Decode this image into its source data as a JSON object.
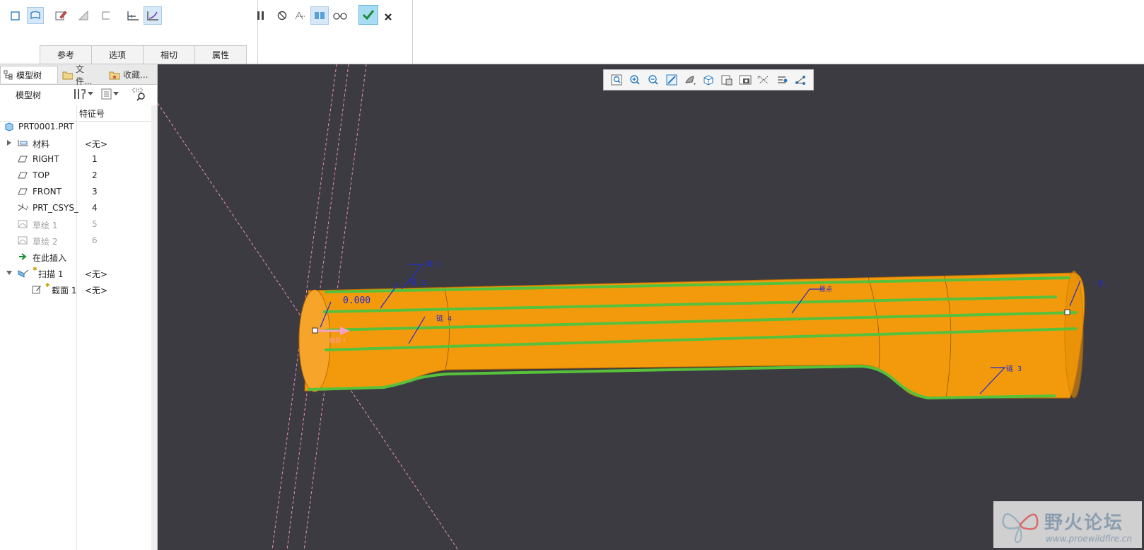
{
  "ribbon": {
    "tabs": [
      "参考",
      "选项",
      "相切",
      "属性"
    ],
    "left_icons": [
      "solid-icon",
      "surface-icon",
      "sketch-edit-icon",
      "remove-material-icon",
      "thin-icon",
      "constant-section-icon",
      "variable-section-icon"
    ],
    "mid_icons": [
      "pause-icon",
      "no-preview-icon",
      "geometry-preview-icon",
      "verify-preview-icon",
      "glasses-icon",
      "confirm-icon",
      "cancel-icon"
    ]
  },
  "panel": {
    "tabs": [
      "模型树",
      "文件...",
      "收藏..."
    ],
    "toolbar_label": "模型树",
    "column_header": "特征号",
    "tree": [
      {
        "name": "PRT0001.PRT",
        "num": "",
        "icon": "part-icon",
        "indent": 0,
        "dim": false
      },
      {
        "name": "材料",
        "num": "<无>",
        "icon": "material-icon",
        "indent": 1,
        "dim": false,
        "expander": true
      },
      {
        "name": "RIGHT",
        "num": "1",
        "icon": "datum-plane-icon",
        "indent": 1,
        "dim": false
      },
      {
        "name": "TOP",
        "num": "2",
        "icon": "datum-plane-icon",
        "indent": 1,
        "dim": false
      },
      {
        "name": "FRONT",
        "num": "3",
        "icon": "datum-plane-icon",
        "indent": 1,
        "dim": false
      },
      {
        "name": "PRT_CSYS_",
        "num": "4",
        "icon": "csys-icon",
        "indent": 1,
        "dim": false
      },
      {
        "name": "草绘 1",
        "num": "5",
        "icon": "sketch-icon",
        "indent": 1,
        "dim": true
      },
      {
        "name": "草绘 2",
        "num": "6",
        "icon": "sketch-icon",
        "indent": 1,
        "dim": true
      },
      {
        "name": "在此插入",
        "num": "",
        "icon": "insert-here-icon",
        "indent": 1,
        "dim": false
      },
      {
        "name": "扫描 1",
        "num": "<无>",
        "icon": "sweep-icon",
        "indent": 1,
        "dim": false,
        "expander": true
      },
      {
        "name": "截面 1",
        "num": "<无>",
        "icon": "section-icon",
        "indent": 2,
        "dim": false
      }
    ]
  },
  "viewport": {
    "toolbar_icons": [
      "refit-icon",
      "zoom-in-icon",
      "zoom-out-icon",
      "repaint-icon",
      "display-style-icon",
      "saved-orientations-icon",
      "view-manager-icon",
      "perspective-icon",
      "datum-display-icon",
      "spin-center-icon",
      "annotation-display-icon"
    ],
    "labels": {
      "chain1": "链 1",
      "chain2": "链 2",
      "chain3": "链 3",
      "chain4": "链 4",
      "origin": "原点",
      "dim_left": "0.000",
      "dim_right": "0.",
      "section": "截面 1"
    }
  },
  "watermark": {
    "title": "野火论坛",
    "url": "www.proewildfire.cn"
  },
  "colors": {
    "viewport_bg": "#3c3b41",
    "body_orange": "#f39a0c",
    "chain_green": "#57c13c",
    "label_blue": "#1f2ad6",
    "datum_pink": "#e98fb0"
  }
}
